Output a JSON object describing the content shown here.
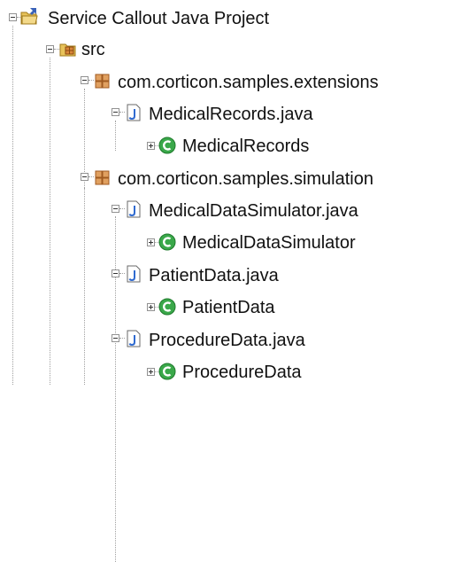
{
  "tree": {
    "project": {
      "label": "Service Callout Java Project",
      "icon": "java-project-icon"
    },
    "src_folder": {
      "label": "src",
      "icon": "source-folder-icon"
    },
    "packages": [
      {
        "label": "com.corticon.samples.extensions",
        "icon": "package-icon",
        "files": [
          {
            "label": "MedicalRecords.java",
            "icon": "java-file-icon",
            "class": {
              "label": "MedicalRecords",
              "icon": "class-icon"
            }
          }
        ]
      },
      {
        "label": "com.corticon.samples.simulation",
        "icon": "package-icon",
        "files": [
          {
            "label": "MedicalDataSimulator.java",
            "icon": "java-file-icon",
            "class": {
              "label": "MedicalDataSimulator",
              "icon": "class-icon"
            }
          },
          {
            "label": "PatientData.java",
            "icon": "java-file-icon",
            "class": {
              "label": "PatientData",
              "icon": "class-icon"
            }
          },
          {
            "label": "ProcedureData.java",
            "icon": "java-file-icon",
            "class": {
              "label": "ProcedureData",
              "icon": "class-icon"
            }
          }
        ]
      }
    ]
  }
}
